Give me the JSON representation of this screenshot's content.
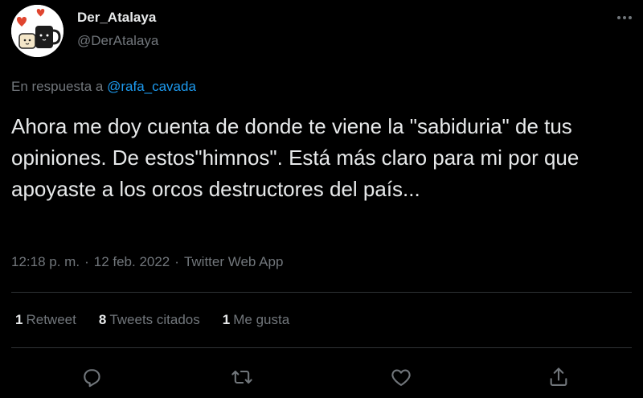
{
  "author": {
    "display_name": "Der_Atalaya",
    "handle": "@DerAtalaya"
  },
  "reply": {
    "prefix": "En respuesta a",
    "mention": "@rafa_cavada"
  },
  "tweet": {
    "text": "Ahora me doy cuenta de donde te viene la \"sabiduria\" de tus opiniones. De estos\"himnos\". Está más claro para mi por que apoyaste a los orcos destructores del país...",
    "time": "12:18 p. m.",
    "separator": "·",
    "date": "12 feb. 2022",
    "source": "Twitter Web App"
  },
  "stats": {
    "retweets_count": "1",
    "retweets_label": "Retweet",
    "quotes_count": "8",
    "quotes_label": "Tweets citados",
    "likes_count": "1",
    "likes_label": "Me gusta"
  },
  "icons": {
    "more": "more-icon",
    "reply": "reply-icon",
    "retweet": "retweet-icon",
    "like": "heart-icon",
    "share": "share-icon"
  },
  "colors": {
    "background": "#000000",
    "text": "#e7e9ea",
    "secondary": "#71767b",
    "accent": "#1d9bf0",
    "divider": "#2f3336"
  }
}
